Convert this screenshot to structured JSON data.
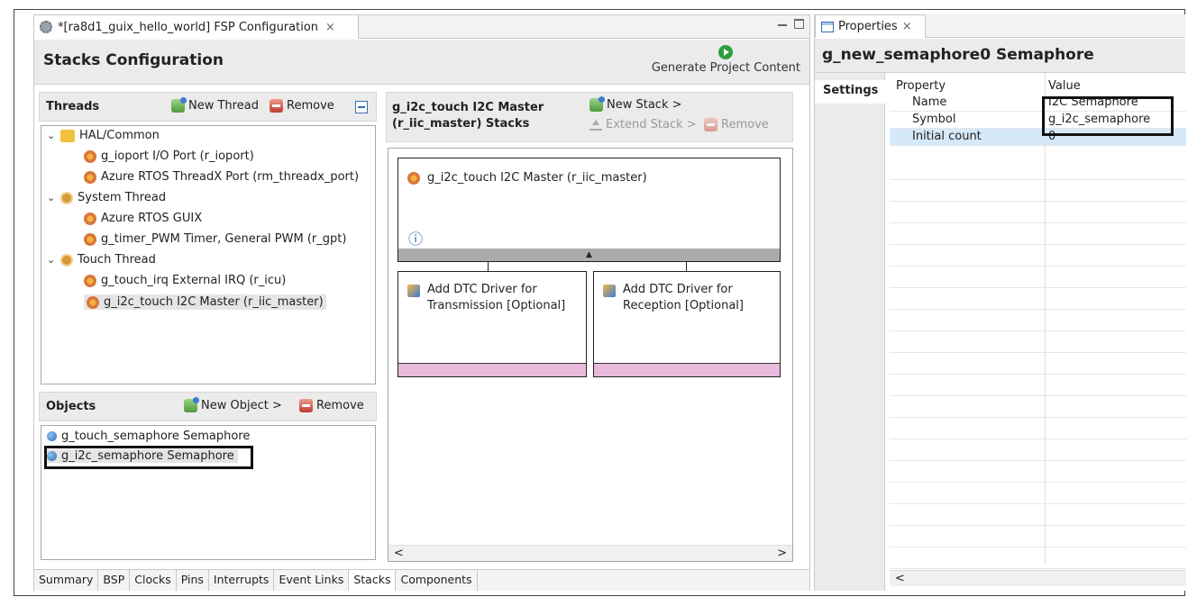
{
  "editor": {
    "tab_title": "*[ra8d1_guix_hello_world] FSP Configuration",
    "tab_close": "×",
    "header_title": "Stacks Configuration",
    "generate_label": "Generate Project Content"
  },
  "threads": {
    "title": "Threads",
    "new_thread": "New Thread",
    "remove": "Remove",
    "tree": [
      {
        "label": "HAL/Common",
        "chev": "⌄"
      },
      {
        "label": "g_ioport I/O Port (r_ioport)"
      },
      {
        "label": "Azure RTOS ThreadX Port (rm_threadx_port)"
      },
      {
        "label": "System Thread",
        "chev": "⌄"
      },
      {
        "label": "Azure RTOS GUIX"
      },
      {
        "label": "g_timer_PWM Timer, General PWM (r_gpt)"
      },
      {
        "label": "Touch Thread",
        "chev": "⌄"
      },
      {
        "label": "g_touch_irq External IRQ (r_icu)"
      },
      {
        "label": "g_i2c_touch I2C Master (r_iic_master)"
      }
    ]
  },
  "objects": {
    "title": "Objects",
    "new_object": "New Object >",
    "remove": "Remove",
    "items": [
      {
        "label": "g_touch_semaphore Semaphore"
      },
      {
        "label": "g_i2c_semaphore Semaphore"
      }
    ]
  },
  "stacks": {
    "title_line1": "g_i2c_touch I2C Master",
    "title_line2": "(r_iic_master) Stacks",
    "new_stack": "New Stack >",
    "extend_stack": "Extend Stack >",
    "remove": "Remove",
    "main_module": "g_i2c_touch I2C Master (r_iic_master)",
    "info_symbol": "ⓘ",
    "up_arrow": "▲",
    "dtc_tx_line1": "Add DTC Driver for",
    "dtc_tx_line2": "Transmission [Optional]",
    "dtc_rx_line1": "Add DTC Driver for",
    "dtc_rx_line2": "Reception [Optional]",
    "scroll_left": "<",
    "scroll_right": ">"
  },
  "bottom_tabs": [
    "Summary",
    "BSP",
    "Clocks",
    "Pins",
    "Interrupts",
    "Event Links",
    "Stacks",
    "Components"
  ],
  "properties": {
    "tab_title": "Properties",
    "tab_close": "×",
    "header_title": "g_new_semaphore0 Semaphore",
    "settings_tab": "Settings",
    "col_property": "Property",
    "col_value": "Value",
    "rows": [
      {
        "property": "Name",
        "value": "I2C Semaphore"
      },
      {
        "property": "Symbol",
        "value": "g_i2c_semaphore"
      },
      {
        "property": "Initial count",
        "value": "0"
      }
    ],
    "scroll_left": "<"
  }
}
